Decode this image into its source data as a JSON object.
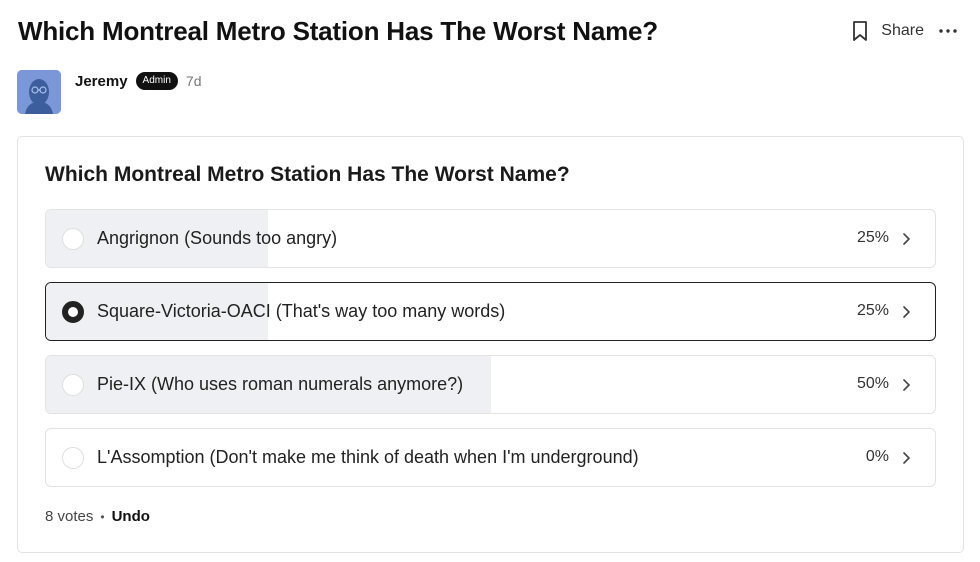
{
  "post": {
    "title": "Which Montreal Metro Station Has The Worst Name?",
    "share_label": "Share",
    "author": "Jeremy",
    "badge": "Admin",
    "age": "7d"
  },
  "poll": {
    "question": "Which Montreal Metro Station Has The Worst Name?",
    "options": [
      {
        "label": "Angrignon (Sounds too angry)",
        "percent": "25%",
        "share": 0.25,
        "selected": false
      },
      {
        "label": "Square-Victoria-OACI (That's way too many words)",
        "percent": "25%",
        "share": 0.25,
        "selected": true
      },
      {
        "label": "Pie-IX (Who uses roman numerals anymore?)",
        "percent": "50%",
        "share": 0.5,
        "selected": false
      },
      {
        "label": "L'Assomption (Don't make me think of death when I'm underground)",
        "percent": "0%",
        "share": 0.0,
        "selected": false
      }
    ],
    "votes": "8 votes",
    "separator": "•",
    "undo_label": "Undo"
  },
  "colors": {
    "fill": "#eef0f3",
    "avatar": "#7b97d8",
    "selected_border": "#222222"
  }
}
